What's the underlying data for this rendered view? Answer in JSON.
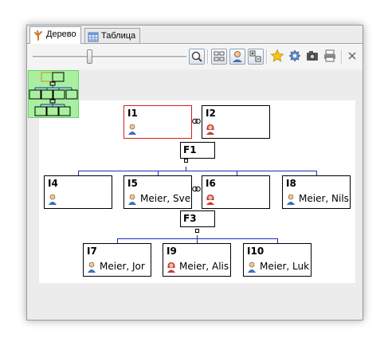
{
  "tabs": [
    {
      "label": "Дерево",
      "icon": "tree-icon",
      "active": true
    },
    {
      "label": "Таблица",
      "icon": "table-icon",
      "active": false
    }
  ],
  "toolbar": {
    "zoom_level": 0.37,
    "buttons": [
      "zoom-fit-icon",
      "layout-grid-icon",
      "person-mode-icon",
      "expand-collapse-icon",
      "star-icon",
      "settings-gear-icon",
      "camera-icon",
      "print-icon",
      "close-x-icon"
    ]
  },
  "colors": {
    "male": "#3d6fb8",
    "female": "#c9383a",
    "connector": "#1c2bbd",
    "selection": "#d42020",
    "minimap": "#a8f0a0"
  },
  "persons": [
    {
      "id": "I1",
      "name": "",
      "sex": "male",
      "selected": true
    },
    {
      "id": "I2",
      "name": "",
      "sex": "female"
    },
    {
      "id": "I4",
      "name": "",
      "sex": "male"
    },
    {
      "id": "I5",
      "name": "Meier, Sve",
      "sex": "male"
    },
    {
      "id": "I6",
      "name": "",
      "sex": "female"
    },
    {
      "id": "I8",
      "name": "Meier, Nils",
      "sex": "male"
    },
    {
      "id": "I7",
      "name": "Meier, Jor",
      "sex": "male"
    },
    {
      "id": "I9",
      "name": "Meier, Alis",
      "sex": "female"
    },
    {
      "id": "I10",
      "name": "Meier, Luk",
      "sex": "male"
    }
  ],
  "families": [
    {
      "id": "F1"
    },
    {
      "id": "F3"
    }
  ]
}
